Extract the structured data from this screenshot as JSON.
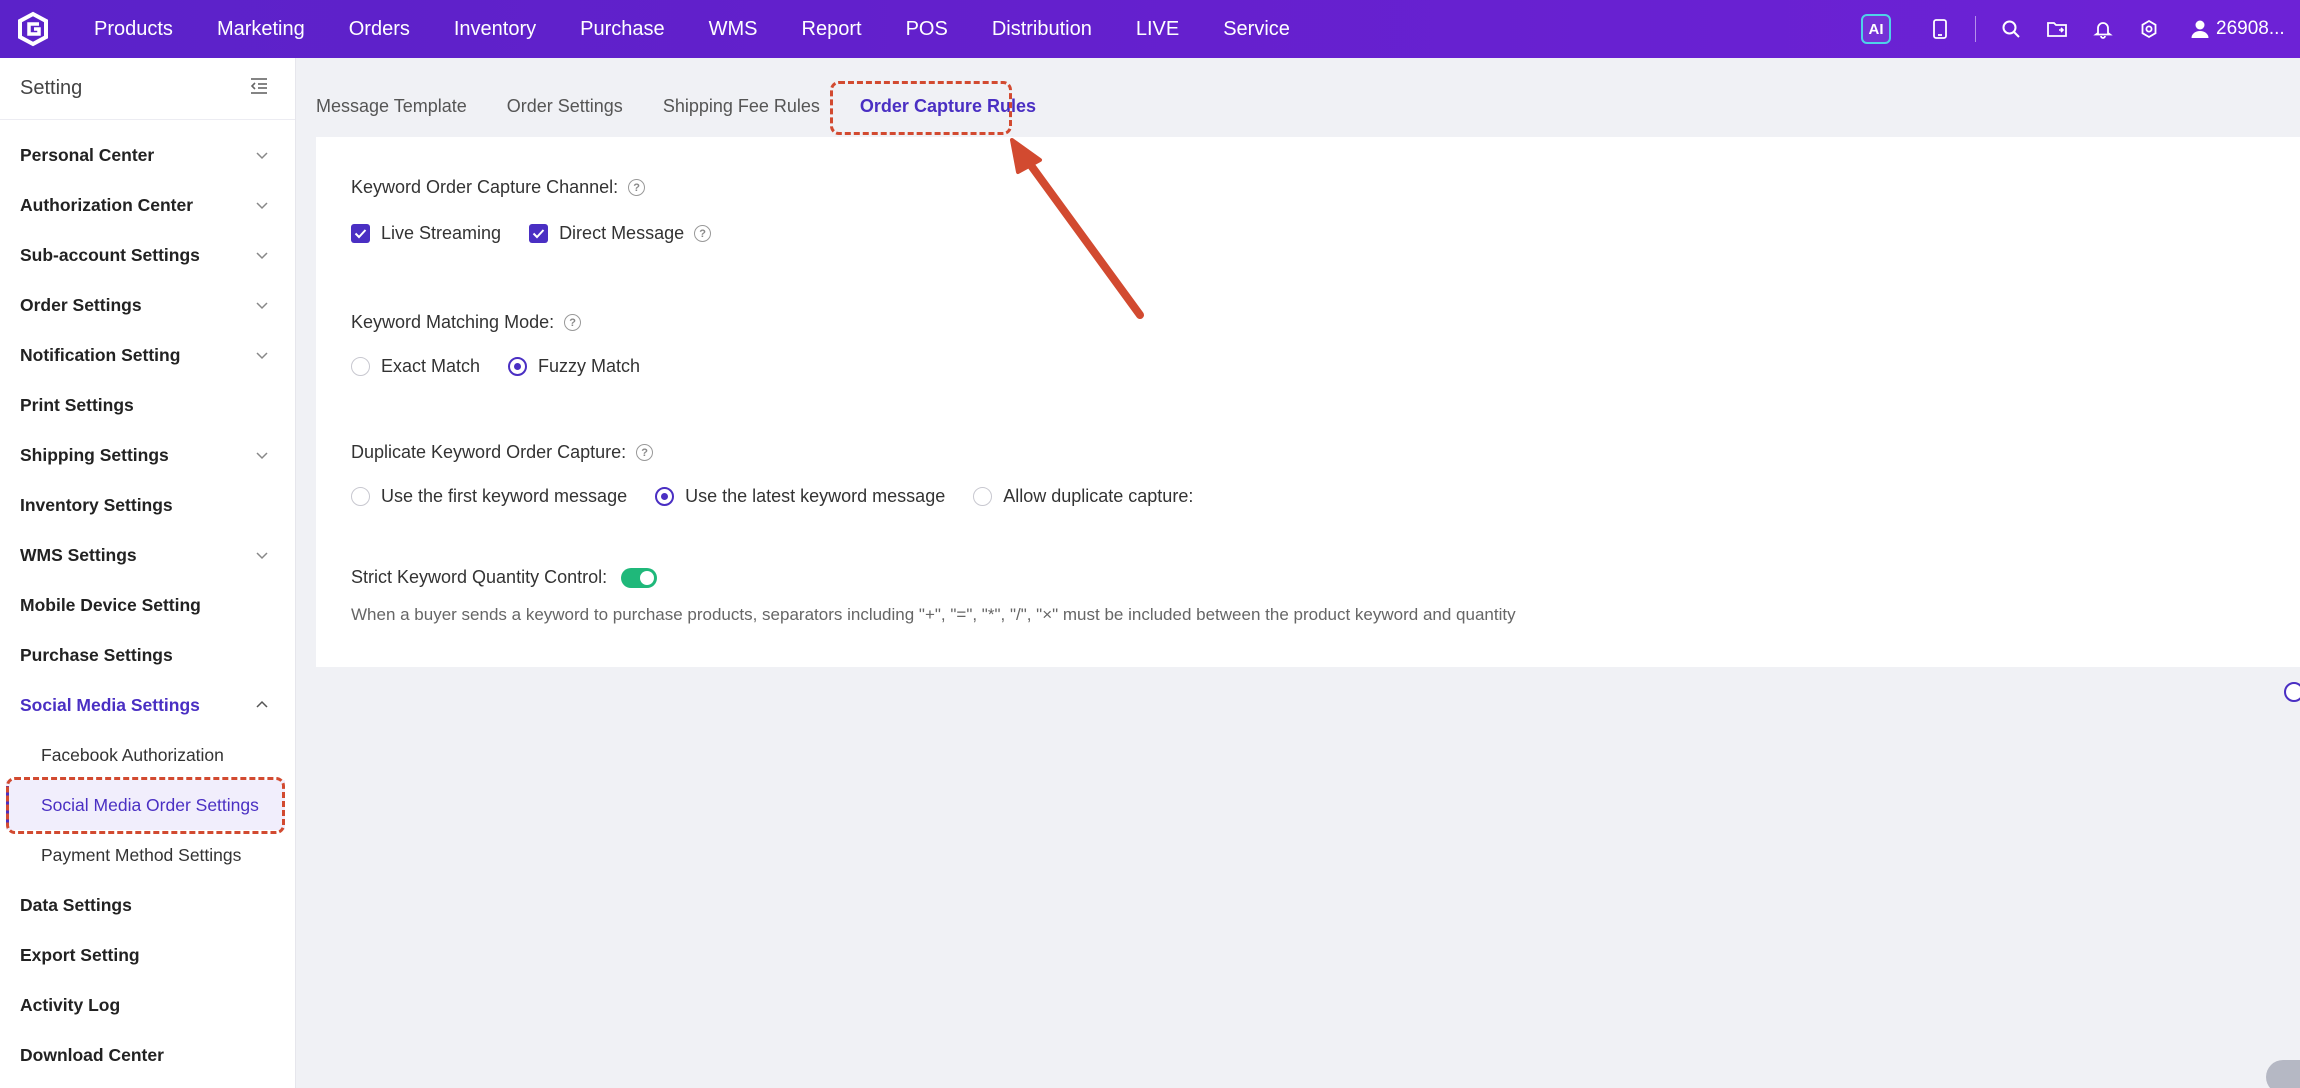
{
  "topnav": {
    "items": [
      "Products",
      "Marketing",
      "Orders",
      "Inventory",
      "Purchase",
      "WMS",
      "Report",
      "POS",
      "Distribution",
      "LIVE",
      "Service"
    ],
    "ai_label": "AI",
    "user": "26908..."
  },
  "sidebar": {
    "title": "Setting",
    "items": [
      {
        "label": "Personal Center"
      },
      {
        "label": "Authorization Center"
      },
      {
        "label": "Sub-account Settings"
      },
      {
        "label": "Order Settings"
      },
      {
        "label": "Notification Setting"
      },
      {
        "label": "Print Settings"
      },
      {
        "label": "Shipping Settings"
      },
      {
        "label": "Inventory Settings"
      },
      {
        "label": "WMS Settings"
      },
      {
        "label": "Mobile Device Setting"
      },
      {
        "label": "Purchase Settings"
      },
      {
        "label": "Social Media Settings"
      },
      {
        "label": "Data Settings"
      },
      {
        "label": "Export Setting"
      },
      {
        "label": "Activity Log"
      },
      {
        "label": "Download Center"
      }
    ],
    "social_sub": [
      "Facebook Authorization",
      "Social Media Order Settings",
      "Payment Method Settings"
    ]
  },
  "tabs": [
    "Message Template",
    "Order Settings",
    "Shipping Fee Rules",
    "Order Capture Rules"
  ],
  "form": {
    "channel_label": "Keyword Order Capture Channel:",
    "channel_opts": [
      "Live Streaming",
      "Direct Message"
    ],
    "matching_label": "Keyword Matching Mode:",
    "matching_opts": [
      "Exact Match",
      "Fuzzy Match"
    ],
    "duplicate_label": "Duplicate Keyword Order Capture:",
    "duplicate_opts": [
      "Use the first keyword message",
      "Use the latest keyword message",
      "Allow duplicate capture:"
    ],
    "strict_label": "Strict Keyword Quantity Control:",
    "strict_desc": "When a buyer sends a keyword to purchase products, separators including \"+\", \"=\", \"*\", \"/\", \"×\" must be included between the product keyword and quantity"
  },
  "colors": {
    "accent": "#4a2fc3",
    "nav": "#5b22c9",
    "toggle": "#1fb87a",
    "annotation": "#d24a30"
  }
}
